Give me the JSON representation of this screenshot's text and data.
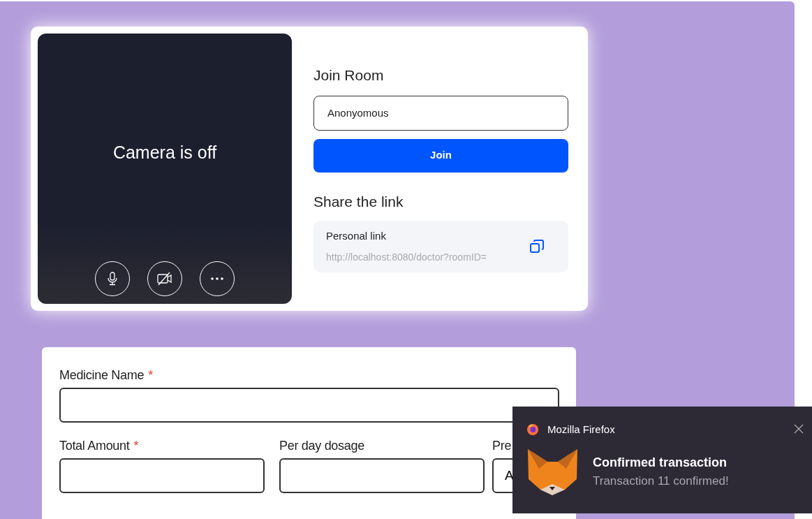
{
  "video": {
    "camera_message": "Camera is off",
    "controls": [
      {
        "kind": "mic"
      },
      {
        "kind": "camera-off"
      },
      {
        "kind": "more"
      }
    ]
  },
  "join": {
    "title": "Join Room",
    "name_field": {
      "value": "Anonyomous"
    },
    "button": "Join"
  },
  "share": {
    "title": "Share the link",
    "link_label": "Personal link",
    "link": "http://localhost:8080/doctor?roomID="
  },
  "form": {
    "fields": [
      {
        "label": "Medicine Name",
        "required_mark": "*"
      }
    ],
    "row": [
      {
        "label": "Total Amount",
        "required_mark": "*"
      },
      {
        "label": "Per day dosage"
      },
      {
        "label": "Pre",
        "value": "A"
      }
    ]
  },
  "notification": {
    "app": "Mozilla Firefox",
    "title": "Confirmed transaction",
    "message": "Transaction 11 confirmed!"
  }
}
